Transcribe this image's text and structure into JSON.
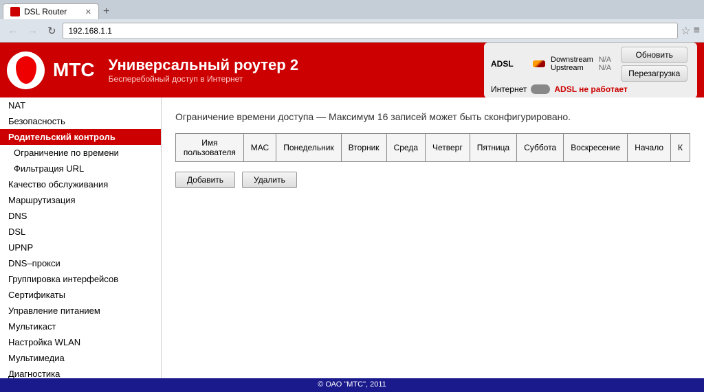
{
  "browser": {
    "tab_title": "DSL Router",
    "tab_new_label": "+",
    "address": "192.168.1.1",
    "nav_back": "←",
    "nav_forward": "→",
    "nav_reload": "↻"
  },
  "header": {
    "brand": "МТС",
    "title": "Универсальный роутер 2",
    "subtitle": "Бесперебойный доступ в Интернет",
    "adsl_label": "ADSL",
    "downstream_label": "Downstream",
    "upstream_label": "Upstream",
    "downstream_value": "N/A",
    "upstream_value": "N/A",
    "internet_label": "Интернет",
    "adsl_status": "ADSL не работает",
    "refresh_btn": "Обновить",
    "reboot_btn": "Перезагрузка"
  },
  "sidebar": {
    "items": [
      {
        "label": "NAT",
        "class": ""
      },
      {
        "label": "Безопасность",
        "class": ""
      },
      {
        "label": "Родительский контроль",
        "class": "active"
      },
      {
        "label": "Ограничение по времени",
        "class": "sub"
      },
      {
        "label": "Фильтрация URL",
        "class": "sub"
      },
      {
        "label": "Качество обслуживания",
        "class": ""
      },
      {
        "label": "Маршрутизация",
        "class": ""
      },
      {
        "label": "DNS",
        "class": ""
      },
      {
        "label": "DSL",
        "class": ""
      },
      {
        "label": "UPNP",
        "class": ""
      },
      {
        "label": "DNS–прокси",
        "class": ""
      },
      {
        "label": "Группировка интерфейсов",
        "class": ""
      },
      {
        "label": "Сертификаты",
        "class": ""
      },
      {
        "label": "Управление питанием",
        "class": ""
      },
      {
        "label": "Мультикаст",
        "class": ""
      },
      {
        "label": "Настройка WLAN",
        "class": ""
      },
      {
        "label": "Мультимедиа",
        "class": ""
      },
      {
        "label": "Диагностика",
        "class": ""
      }
    ]
  },
  "main": {
    "page_title": "Ограничение времени доступа — Максимум 16 записей может быть сконфигурировано.",
    "table": {
      "columns": [
        "Имя пользователя",
        "МАС",
        "Понедельник",
        "Вторник",
        "Среда",
        "Четверг",
        "Пятница",
        "Суббота",
        "Воскресение",
        "Начало",
        "К"
      ],
      "rows": []
    },
    "add_btn": "Добавить",
    "delete_btn": "Удалить"
  },
  "footer": {
    "text": "© ОАО \"МТС\", 2011"
  }
}
